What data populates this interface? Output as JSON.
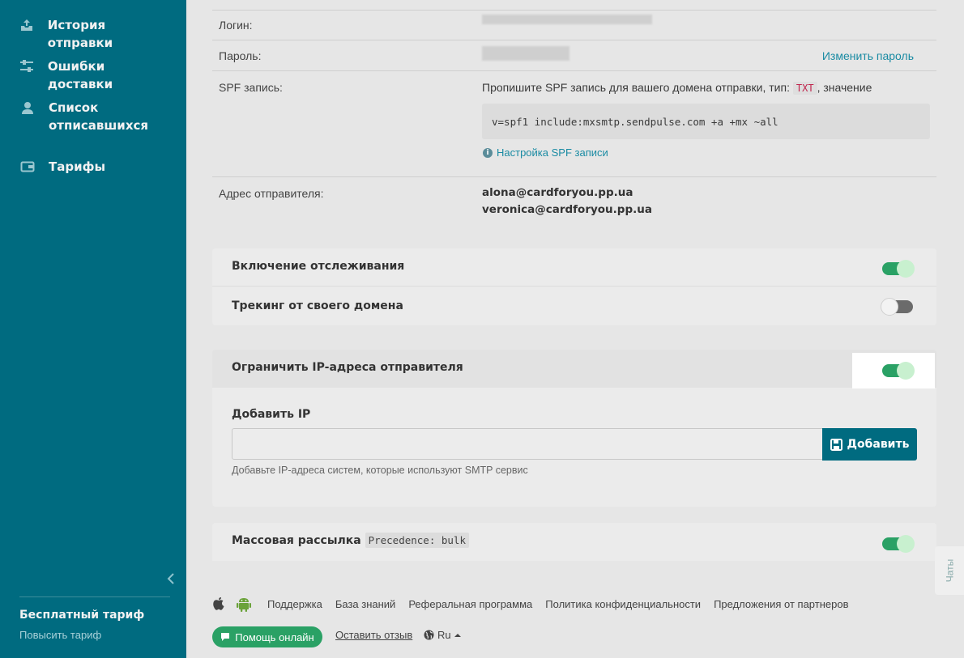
{
  "sidebar": {
    "items": [
      {
        "label": "История отправки",
        "icon": "upload-tray-icon"
      },
      {
        "label": "Ошибки доставки",
        "icon": "sliders-icon"
      },
      {
        "label": "Список отписавшихся",
        "icon": "user-icon"
      },
      {
        "label": "Тарифы",
        "icon": "wallet-icon"
      }
    ],
    "collapse_label": "‹",
    "plan_name": "Бесплатный тариф",
    "plan_upgrade": "Повысить тариф"
  },
  "settings": {
    "login_label": "Логин:",
    "password_label": "Пароль:",
    "change_password": "Изменить пароль",
    "spf_label": "SPF запись:",
    "spf_intro": "Пропишите SPF запись для вашего домена отправки, тип:",
    "spf_type": "TXT",
    "spf_value_suffix": ", значение",
    "spf_value": "v=spf1 include:mxsmtp.sendpulse.com +a +mx ~all",
    "spf_help": "Настройка SPF записи",
    "sender_label": "Адрес отправителя:",
    "sender_emails": [
      "alona@cardforyou.pp.ua",
      "veronica@cardforyou.pp.ua"
    ]
  },
  "tracking": {
    "enable_label": "Включение отслеживания",
    "enable_on": true,
    "own_domain_label": "Трекинг от своего домена",
    "own_domain_on": false
  },
  "ip_restrict": {
    "title": "Ограничить IP-адреса отправителя",
    "on": true,
    "add_label": "Добавить IP",
    "input_value": "",
    "button_label": "Добавить",
    "hint": "Добавьте IP-адреса систем, которые используют SMTP сервис"
  },
  "bulk": {
    "title": "Массовая рассылка",
    "tag": "Precedence: bulk",
    "on": true
  },
  "footer": {
    "links": [
      "Поддержка",
      "База знаний",
      "Реферальная программа",
      "Политика конфиденциальности",
      "Предложения от партнеров"
    ],
    "help_button": "Помощь онлайн",
    "feedback": "Оставить отзыв",
    "language": "Ru",
    "chats": "Чаты"
  },
  "colors": {
    "sidebar": "#006b80",
    "toggle_on": "#2aa165",
    "link": "#1a8ba3"
  }
}
